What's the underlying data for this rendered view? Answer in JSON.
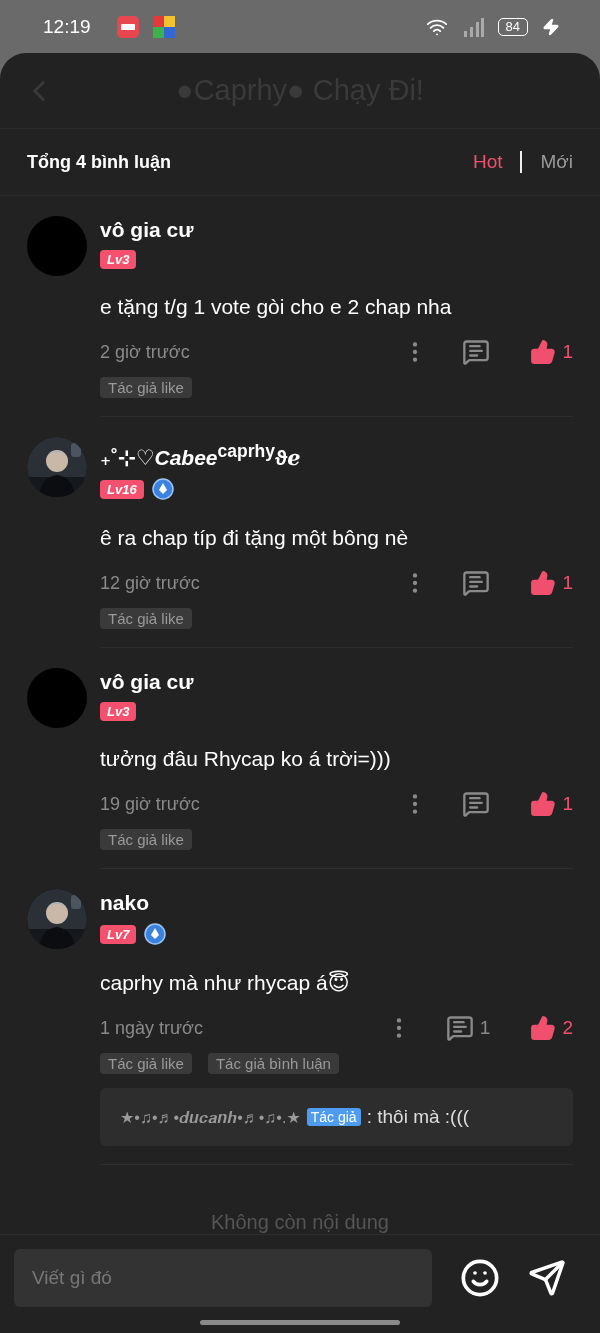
{
  "status_bar": {
    "time": "12:19",
    "battery": "84"
  },
  "header": {
    "title": "●Caprhy● Chạy Đi!"
  },
  "summary": {
    "count_label": "Tổng 4 bình luận",
    "sort_tabs": [
      {
        "label": "Hot",
        "selected": true
      },
      {
        "label": "Mới",
        "selected": false
      }
    ]
  },
  "comments": [
    {
      "avatar": {
        "kind": "plain"
      },
      "name": "vô gia cư",
      "level": "Lv3",
      "verified": false,
      "text": "e tặng t/g 1 vote gòi cho e 2 chap nha",
      "time": "2 giờ trước",
      "likes": "1",
      "tags": [
        "Tác giả like"
      ]
    },
    {
      "avatar": {
        "kind": "picture"
      },
      "name": "₊˚⊹♡*Cabee*$^{caprhy}$ϑℯ",
      "level": "Lv16",
      "verified": true,
      "text": "ê ra chap típ đi tặng một bông nè",
      "time": "12 giờ trước",
      "likes": "1",
      "tags": [
        "Tác giả like"
      ]
    },
    {
      "avatar": {
        "kind": "plain"
      },
      "name": "vô gia cư",
      "level": "Lv3",
      "verified": false,
      "text": "tưởng đâu Rhycap ko á trời=)))",
      "time": "19 giờ trước",
      "likes": "1",
      "tags": [
        "Tác giả like"
      ]
    },
    {
      "avatar": {
        "kind": "picture"
      },
      "name": "nako",
      "level": "Lv7",
      "verified": true,
      "text": "caprhy mà như rhycap á😇",
      "time": "1 ngày trước",
      "reply_count": "1",
      "likes": "2",
      "tags": [
        "Tác giả like",
        "Tác giả bình luận"
      ],
      "replies": [
        {
          "author": "★•♫•♬•𝒅𝒖𝒄𝒂𝒏𝒉•♬•♫•.★",
          "badge": "Tác giả",
          "text": ": thôi mà :((("
        }
      ]
    }
  ],
  "footer_note": "Không còn nội dung",
  "composer": {
    "placeholder": "Viết gì đó"
  }
}
